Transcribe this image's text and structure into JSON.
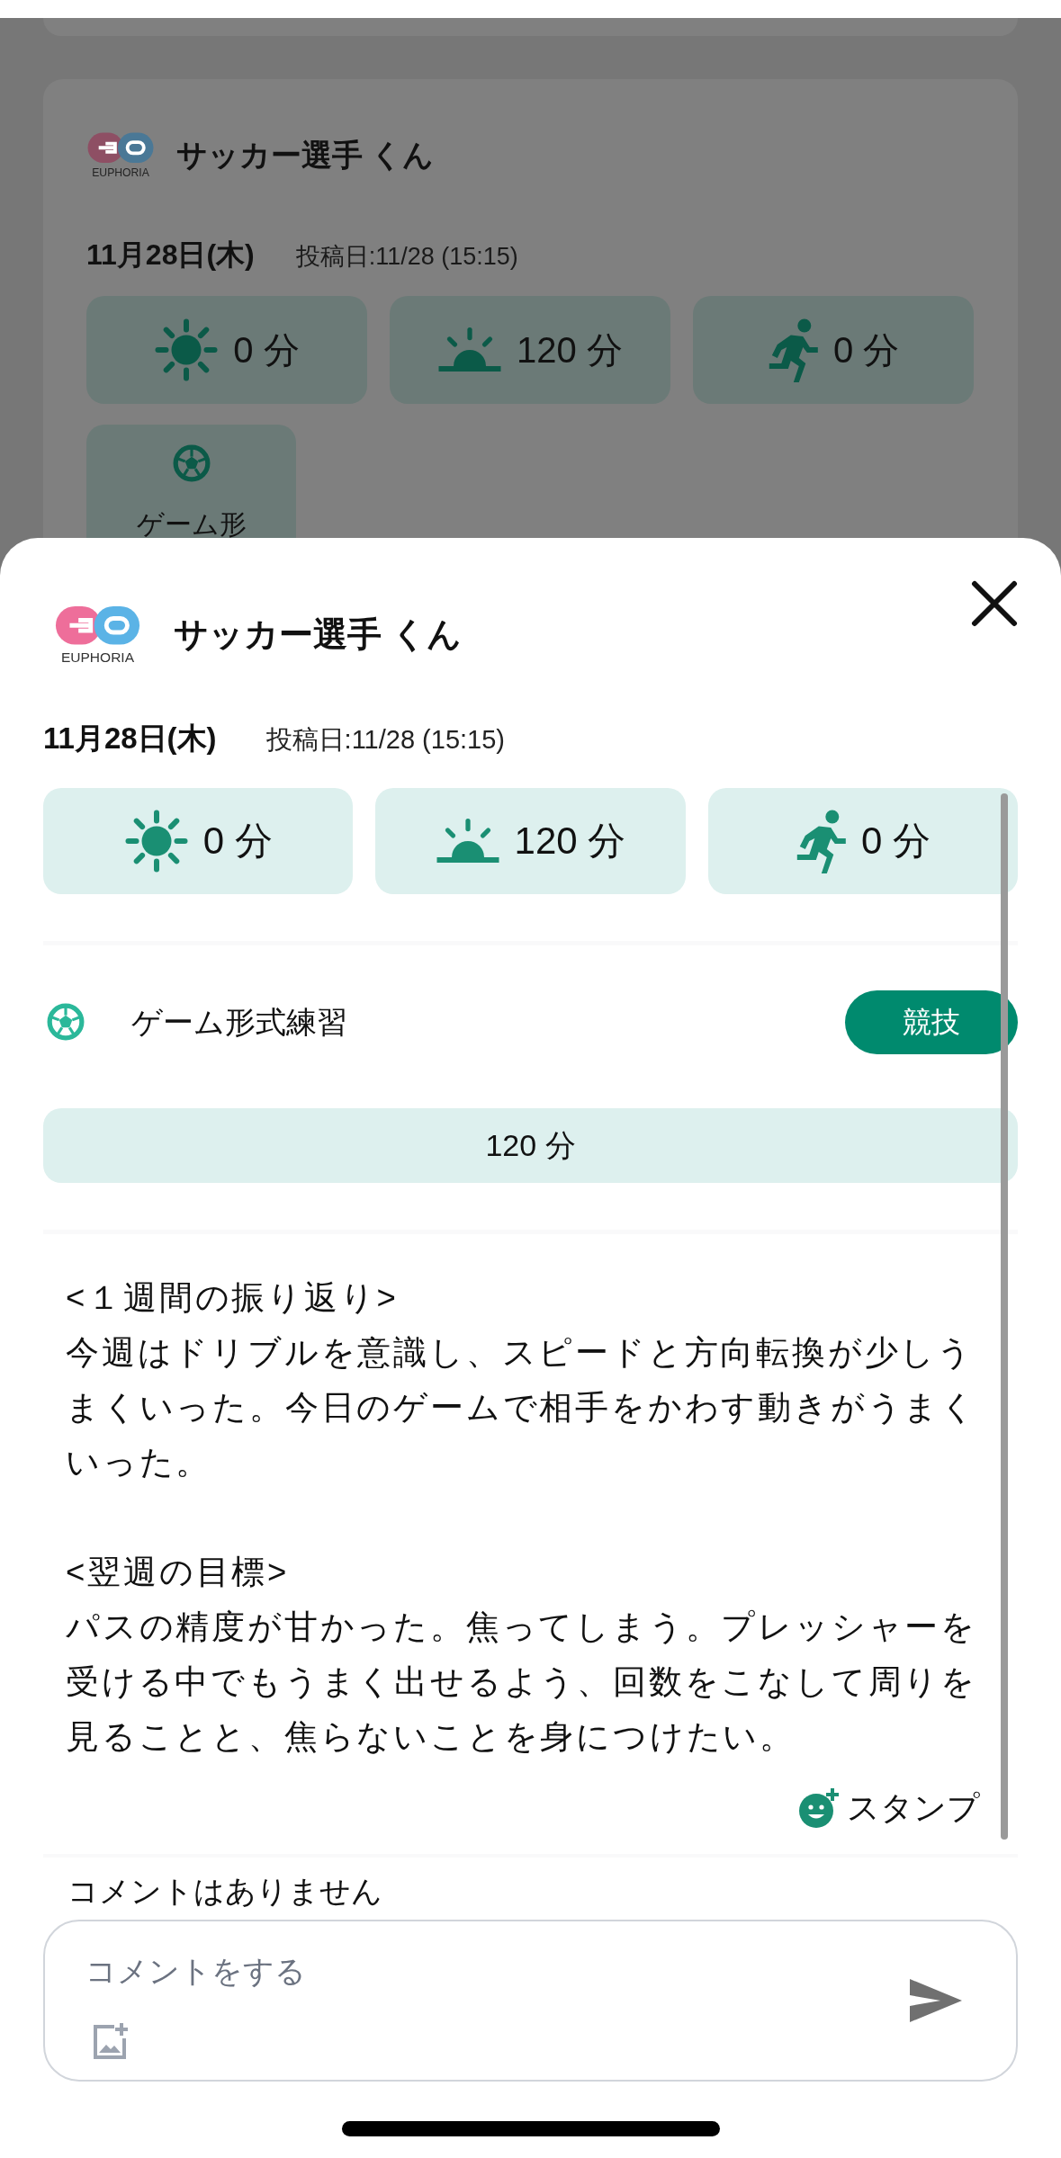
{
  "background_post": {
    "logo_text": "EUPHORIA",
    "author": "サッカー選手 くん",
    "date": "11月28日(木)",
    "posted": "投稿日:11/28 (15:15)",
    "stats": [
      {
        "kind": "sun",
        "value": "0 分"
      },
      {
        "kind": "sunrise",
        "value": "120 分"
      },
      {
        "kind": "run",
        "value": "0 分"
      }
    ],
    "activities": [
      {
        "kind": "soccer",
        "label": "ゲーム形"
      }
    ]
  },
  "sheet": {
    "logo_text": "EUPHORIA",
    "author": "サッカー選手 くん",
    "date": "11月28日(木)",
    "posted": "投稿日:11/28 (15:15)",
    "stats": [
      {
        "kind": "sun",
        "value": "0 分"
      },
      {
        "kind": "sunrise",
        "value": "120 分"
      },
      {
        "kind": "run",
        "value": "0 分"
      }
    ],
    "activity": {
      "kind": "soccer",
      "label": "ゲーム形式練習",
      "tag": "競技",
      "duration": "120 分"
    },
    "report": "<１週間の振り返り>\n今週はドリブルを意識し、スピードと方向転換が少しうまくいった。今日のゲームで相手をかわす動きがうまくいった。\n\n<翌週の目標>\nパスの精度が甘かった。焦ってしまう。プレッシャーを受ける中でもうまく出せるよう、回数をこなして周りを見ることと、焦らないことを身につけたい。",
    "stamp_button": "スタンプ",
    "comments_empty": "コメントはありません",
    "comment_field": {
      "placeholder": "コメントをする"
    }
  }
}
